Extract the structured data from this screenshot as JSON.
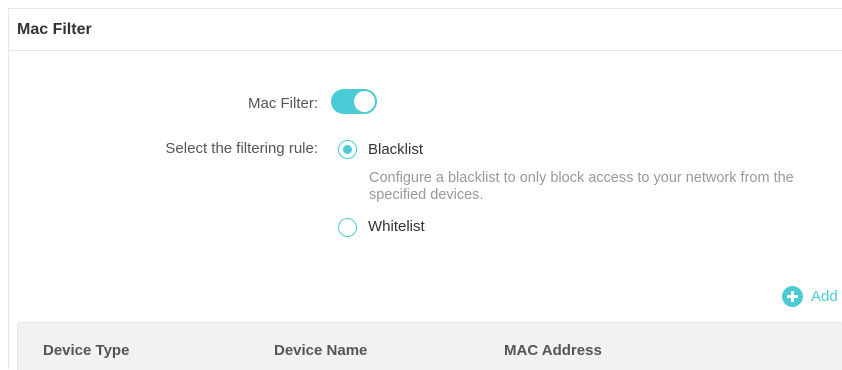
{
  "panel": {
    "title": "Mac Filter"
  },
  "mac_filter": {
    "label": "Mac Filter:",
    "enabled": true
  },
  "filtering_rule": {
    "label": "Select the filtering rule:",
    "selected": "Blacklist",
    "options": [
      {
        "label": "Blacklist",
        "description": "Configure a blacklist to only block access to your network from the specified devices."
      },
      {
        "label": "Whitelist"
      }
    ]
  },
  "actions": {
    "add_label": "Add"
  },
  "table": {
    "columns": [
      "Device Type",
      "Device Name",
      "MAC Address"
    ]
  },
  "colors": {
    "accent": "#4acbd6",
    "header_bg": "#f2f2f2",
    "hint_text": "#999999"
  }
}
